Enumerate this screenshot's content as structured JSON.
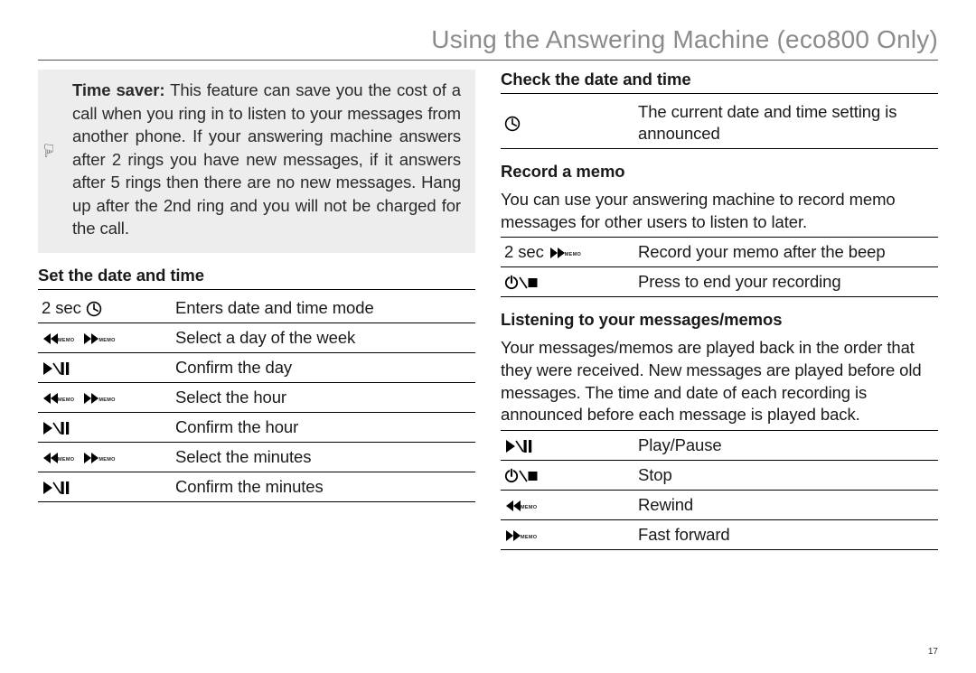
{
  "page": {
    "title": "Using the Answering Machine (eco800 Only)",
    "number": "17"
  },
  "tip": {
    "label": "Time saver:",
    "text": " This feature can save you the cost of a call when you ring in to listen to your messages from another phone. If your answering machine answers after 2 rings you have new messages, if it answers after 5 rings then there are no new messages. Hang up after the 2nd ring and you will not be charged for the call."
  },
  "set_datetime": {
    "heading": "Set the date and time",
    "rows": [
      {
        "prefix": "2 sec ",
        "icon": "clock",
        "desc": "Enters date and time mode"
      },
      {
        "icon": "rew-ff-memo",
        "desc": "Select a day of the week"
      },
      {
        "icon": "play-pause",
        "desc": "Confirm the day"
      },
      {
        "icon": "rew-ff-memo",
        "desc": "Select the hour"
      },
      {
        "icon": "play-pause",
        "desc": "Confirm the hour"
      },
      {
        "icon": "rew-ff-memo",
        "desc": "Select the minutes"
      },
      {
        "icon": "play-pause",
        "desc": "Confirm the minutes"
      }
    ]
  },
  "check_datetime": {
    "heading": "Check the date and time",
    "rows": [
      {
        "icon": "clock",
        "desc": "The current date and time setting is announced"
      }
    ]
  },
  "record_memo": {
    "heading": "Record a memo",
    "intro": "You can use your answering machine to record memo messages for other users to listen to later.",
    "rows": [
      {
        "prefix": "2 sec ",
        "icon": "ff-memo",
        "desc": "Record your memo after the beep"
      },
      {
        "icon": "power-stop",
        "desc": "Press to end your recording"
      }
    ]
  },
  "listen": {
    "heading": "Listening to your messages/memos",
    "intro": "Your messages/memos are played back in the order that they were received. New messages are played before old messages. The time and date of each recording is announced before each message is played back.",
    "rows": [
      {
        "icon": "play-pause",
        "desc": "Play/Pause"
      },
      {
        "icon": "power-stop",
        "desc": "Stop"
      },
      {
        "icon": "rew-memo",
        "desc": "Rewind"
      },
      {
        "icon": "ff-memo",
        "desc": "Fast forward"
      }
    ]
  },
  "icons": {
    "memo_text": "MEMO"
  }
}
